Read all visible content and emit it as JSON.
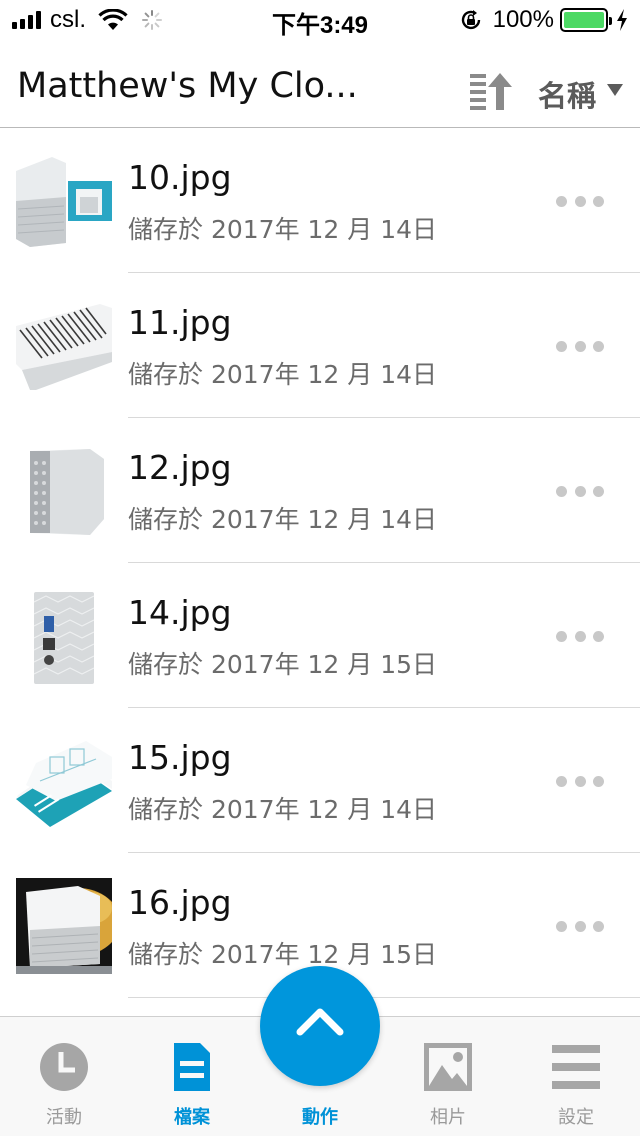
{
  "status_bar": {
    "carrier": "csl.",
    "time": "下午3:49",
    "battery_percent": "100%",
    "battery_level": 1.0,
    "signal_bars": 4,
    "battery_color": "#4cd964"
  },
  "header": {
    "title": "Matthew's My Clo...",
    "sort_label": "名稱"
  },
  "files": [
    {
      "name": "10.jpg",
      "date": "儲存於 2017年 12 月 14日"
    },
    {
      "name": "11.jpg",
      "date": "儲存於 2017年 12 月 14日"
    },
    {
      "name": "12.jpg",
      "date": "儲存於 2017年 12 月 14日"
    },
    {
      "name": "14.jpg",
      "date": "儲存於 2017年 12 月 15日"
    },
    {
      "name": "15.jpg",
      "date": "儲存於 2017年 12 月 14日"
    },
    {
      "name": "16.jpg",
      "date": "儲存於 2017年 12 月 15日"
    }
  ],
  "tab_bar": {
    "tabs": [
      {
        "label": "活動",
        "icon": "clock-icon",
        "active": false
      },
      {
        "label": "檔案",
        "icon": "document-icon",
        "active": true
      },
      {
        "label": "動作",
        "icon": "chevron-up-icon",
        "active": true
      },
      {
        "label": "相片",
        "icon": "photo-icon",
        "active": false
      },
      {
        "label": "設定",
        "icon": "menu-icon",
        "active": false
      }
    ],
    "accent_color": "#0092d7",
    "inactive_color": "#9a9a9a"
  }
}
